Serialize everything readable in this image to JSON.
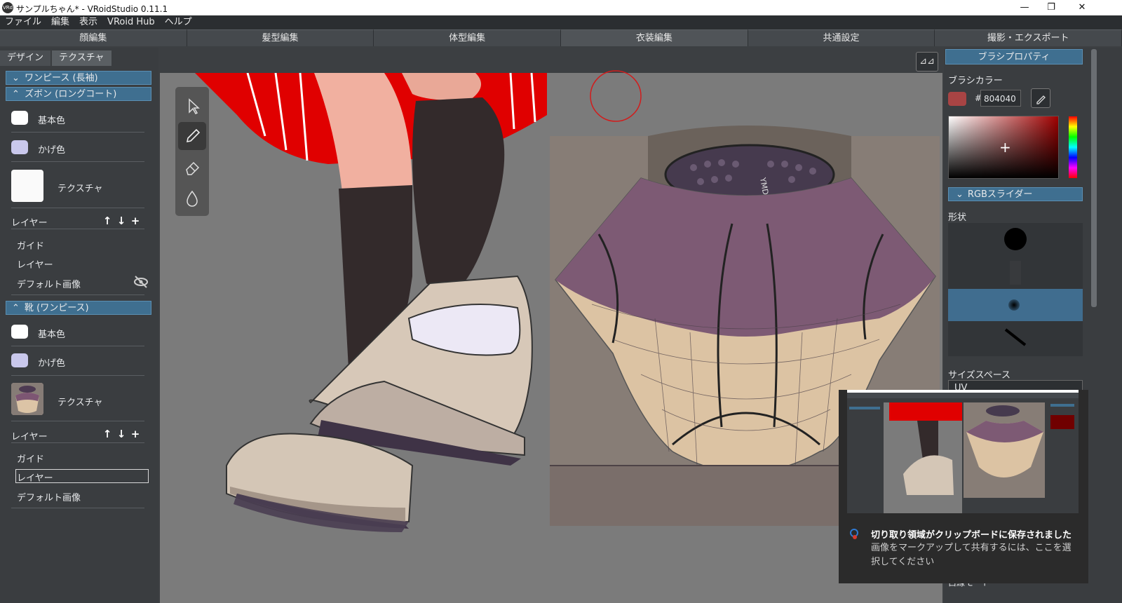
{
  "window": {
    "title": "サンプルちゃん* - VRoidStudio 0.11.1",
    "logo_text": "VRd",
    "minimize_icon": "minimize-icon",
    "maximize_icon": "restore-icon",
    "close_icon": "close-icon"
  },
  "menu": [
    "ファイル",
    "編集",
    "表示",
    "VRoid Hub",
    "ヘルプ"
  ],
  "mode_tabs": [
    "顔編集",
    "髪型編集",
    "体型編集",
    "衣装編集",
    "共通設定",
    "撮影・エクスポート"
  ],
  "sub_tabs": {
    "design": "デザイン",
    "texture": "テクスチャ"
  },
  "left": {
    "section1": "ワンピース (長袖)",
    "section2": "ズボン (ロングコート)",
    "s2_base_color": "基本色",
    "s2_shadow_color": "かげ色",
    "s2_texture": "テクスチャ",
    "s2_layer": "レイヤー",
    "s2_guide": "ガイド",
    "s2_layer_item": "レイヤー",
    "s2_default_image": "デフォルト画像",
    "section3": "靴 (ワンピース)",
    "s3_base_color": "基本色",
    "s3_shadow_color": "かげ色",
    "s3_texture": "テクスチャ",
    "s3_layer": "レイヤー",
    "s3_guide": "ガイド",
    "s3_layer_item": "レイヤー",
    "s3_default_image": "デフォルト画像",
    "layer_up": "↑",
    "layer_down": "↓",
    "layer_add": "+"
  },
  "colors": {
    "base": "#ffffff",
    "shadow": "#c9c8ec",
    "brush": "#a84444",
    "accent": "#3f6f90"
  },
  "viewport": {
    "mirror_button": "⊿⊿",
    "tools": [
      "select-icon",
      "pen-icon",
      "eraser-icon",
      "fill-icon"
    ]
  },
  "right": {
    "title": "ブラシプロパティ",
    "brush_color_label": "ブラシカラー",
    "hash": "#",
    "hex_value": "804040",
    "picker_plus": "+",
    "rgb_slider": "RGBスライダー",
    "shape_label": "形状",
    "size_space_label": "サイズスペース",
    "size_space_value": "UV",
    "cut_label": "白線モード"
  },
  "toast": {
    "heading": "切り取り領域がクリップボードに保存されました",
    "body": "画像をマークアップして共有するには、ここを選択してください"
  }
}
